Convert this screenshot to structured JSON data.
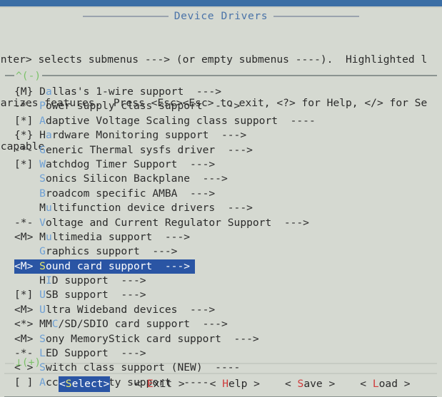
{
  "window": {
    "accent_color": "#3b6ea5",
    "background_color": "#d5d9d1",
    "title": "Device Drivers"
  },
  "help": {
    "lines": [
      "Enter> selects submenus ---> (or empty submenus ----).  Highlighted l",
      "larizes features.  Press <Esc><Esc> to exit, <?> for Help, </> for Se",
      " capable"
    ]
  },
  "list": {
    "scroll_up_marker": "^(-)",
    "scroll_down_marker": "⊥(+)",
    "items": [
      {
        "marker": "{M}",
        "pre": "D",
        "hotkey": "a",
        "post": "llas's 1-wire support  --->"
      },
      {
        "marker": "-*-",
        "pre": "",
        "hotkey": "P",
        "post": "ower supply class support  --->"
      },
      {
        "marker": "[*]",
        "pre": "",
        "hotkey": "A",
        "post": "daptive Voltage Scaling class support  ----"
      },
      {
        "marker": "{*}",
        "pre": "H",
        "hotkey": "a",
        "post": "rdware Monitoring support  --->"
      },
      {
        "marker": "-*-",
        "pre": "",
        "hotkey": "G",
        "post": "eneric Thermal sysfs driver  --->"
      },
      {
        "marker": "[*]",
        "pre": "",
        "hotkey": "W",
        "post": "atchdog Timer Support  --->"
      },
      {
        "marker": "   ",
        "pre": "",
        "hotkey": "S",
        "post": "onics Silicon Backplane  --->"
      },
      {
        "marker": "   ",
        "pre": "",
        "hotkey": "B",
        "post": "roadcom specific AMBA  --->"
      },
      {
        "marker": "   ",
        "pre": "M",
        "hotkey": "u",
        "post": "ltifunction device drivers  --->"
      },
      {
        "marker": "-*-",
        "pre": "",
        "hotkey": "V",
        "post": "oltage and Current Regulator Support  --->"
      },
      {
        "marker": "<M>",
        "pre": "M",
        "hotkey": "u",
        "post": "ltimedia support  --->"
      },
      {
        "marker": "   ",
        "pre": "",
        "hotkey": "G",
        "post": "raphics support  --->"
      },
      {
        "marker": "<M>",
        "pre": "",
        "hotkey": "S",
        "post": "ound card support  --->",
        "selected": true
      },
      {
        "marker": "   ",
        "pre": "H",
        "hotkey": "I",
        "post": "D support  --->"
      },
      {
        "marker": "[*]",
        "pre": "",
        "hotkey": "U",
        "post": "SB support  --->"
      },
      {
        "marker": "<M>",
        "pre": "",
        "hotkey": "U",
        "post": "ltra Wideband devices  --->"
      },
      {
        "marker": "<*>",
        "pre": "MM",
        "hotkey": "C",
        "post": "/SD/SDIO card support  --->"
      },
      {
        "marker": "<M>",
        "pre": "",
        "hotkey": "S",
        "post": "ony MemoryStick card support  --->"
      },
      {
        "marker": "-*-",
        "pre": "",
        "hotkey": "L",
        "post": "ED Support  --->"
      },
      {
        "marker": "< >",
        "pre": "",
        "hotkey": "S",
        "post": "witch class support (NEW)  ----"
      },
      {
        "marker": "[ ]",
        "pre": "",
        "hotkey": "A",
        "post": "ccessibility support  ----"
      }
    ]
  },
  "buttons": [
    {
      "left": "<",
      "pre": "",
      "hotkey": "S",
      "post": "elect>",
      "active": true
    },
    {
      "left": "< ",
      "pre": "",
      "hotkey": "E",
      "post": "xit >",
      "active": false
    },
    {
      "left": "< ",
      "pre": "",
      "hotkey": "H",
      "post": "elp >",
      "active": false
    },
    {
      "left": "< ",
      "pre": "",
      "hotkey": "S",
      "post": "ave >",
      "active": false
    },
    {
      "left": "< ",
      "pre": "",
      "hotkey": "L",
      "post": "oad >",
      "active": false
    }
  ]
}
